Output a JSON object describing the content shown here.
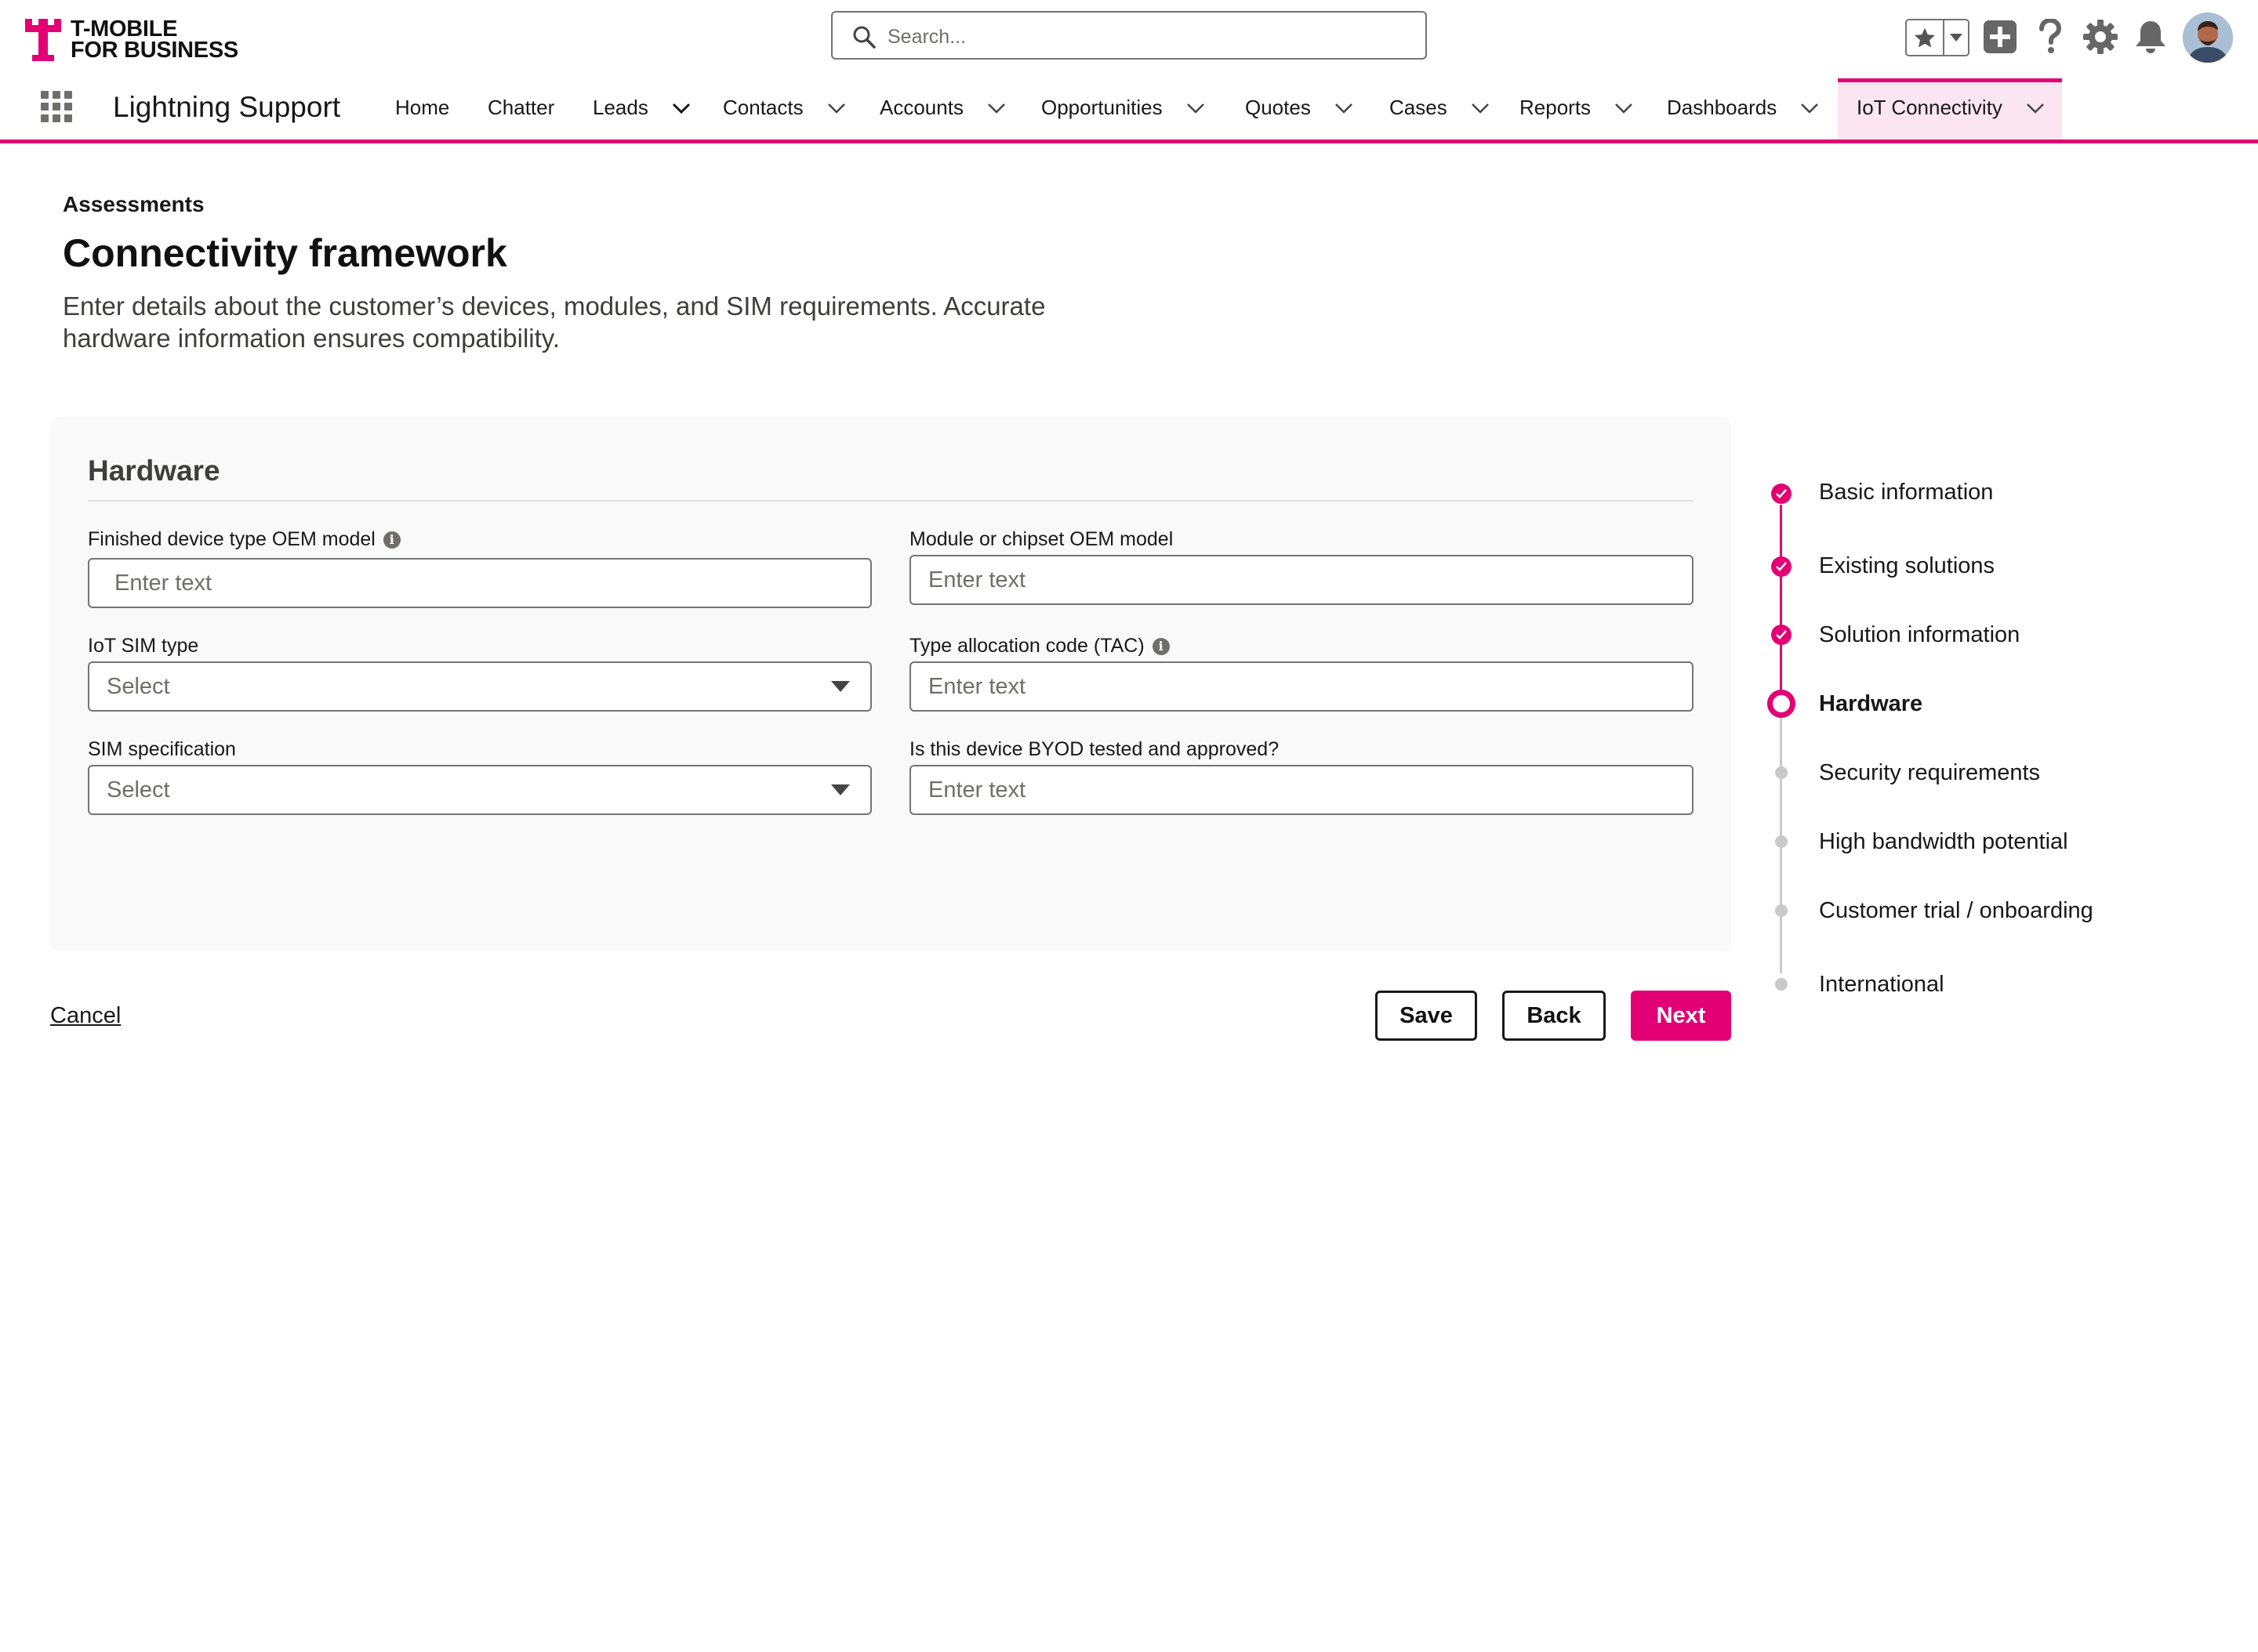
{
  "brand": {
    "line1": "T-MOBILE",
    "line2": "FOR BUSINESS",
    "accent": "#e20074"
  },
  "header": {
    "search_placeholder": "Search...",
    "icons": [
      "star-icon",
      "chevron-down-icon",
      "plus-icon",
      "help-icon",
      "gear-icon",
      "bell-icon",
      "avatar"
    ]
  },
  "nav": {
    "app_name": "Lightning Support",
    "items": [
      {
        "label": "Home"
      },
      {
        "label": "Chatter"
      },
      {
        "label": "Leads"
      },
      {
        "label": "Contacts"
      },
      {
        "label": "Accounts"
      },
      {
        "label": "Opportunities"
      },
      {
        "label": "Quotes"
      },
      {
        "label": "Cases"
      },
      {
        "label": "Reports"
      },
      {
        "label": "Dashboards"
      },
      {
        "label": "IoT Connectivity"
      }
    ],
    "active": "IoT Connectivity"
  },
  "page": {
    "breadcrumb": "Assessments",
    "title": "Connectivity framework",
    "description_line1": "Enter details about the customer’s devices, modules, and SIM requirements. Accurate",
    "description_line2": "hardware information ensures compatibility."
  },
  "form": {
    "section_title": "Hardware",
    "fields": {
      "oem_model": {
        "label": "Finished device type OEM model",
        "placeholder": "Enter text"
      },
      "module_model": {
        "label": "Module or chipset OEM model",
        "placeholder": "Enter text"
      },
      "sim_type": {
        "label": "IoT SIM type",
        "value": "Select"
      },
      "tac": {
        "label": "Type allocation code (TAC)",
        "placeholder": "Enter text"
      },
      "sim_spec": {
        "label": "SIM specification",
        "value": "Select"
      },
      "byod": {
        "label": "Is this device BYOD tested and approved?",
        "placeholder": "Enter text"
      }
    }
  },
  "actions": {
    "cancel": "Cancel",
    "save": "Save",
    "back": "Back",
    "next": "Next"
  },
  "stepper": {
    "steps": [
      {
        "label": "Basic information",
        "state": "done"
      },
      {
        "label": "Existing solutions",
        "state": "done"
      },
      {
        "label": "Solution information",
        "state": "done"
      },
      {
        "label": "Hardware",
        "state": "current"
      },
      {
        "label": "Security requirements",
        "state": "todo"
      },
      {
        "label": "High bandwidth potential",
        "state": "todo"
      },
      {
        "label": "Customer trial / onboarding",
        "state": "todo"
      },
      {
        "label": "International",
        "state": "todo"
      }
    ]
  }
}
